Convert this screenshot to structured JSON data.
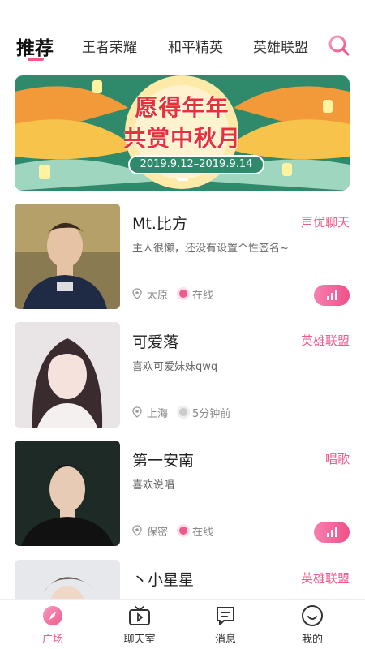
{
  "top_tabs": [
    {
      "label": "推荐",
      "active": true
    },
    {
      "label": "王者荣耀",
      "active": false
    },
    {
      "label": "和平精英",
      "active": false
    },
    {
      "label": "英雄联盟",
      "active": false
    }
  ],
  "banner": {
    "line1": "愿得年年",
    "line2": "共赏中秋月",
    "date_range": "2019.9.12–2019.9.14"
  },
  "users": [
    {
      "name": "Mt.比方",
      "tag": "声优聊天",
      "signature": "主人很懒，还没有设置个性签名~",
      "location": "太原",
      "status": "在线",
      "online": true,
      "voice_button": true
    },
    {
      "name": "可爱落",
      "tag": "英雄联盟",
      "signature": "喜欢可爱妹妹qwq",
      "location": "上海",
      "status": "5分钟前",
      "online": false,
      "voice_button": false
    },
    {
      "name": "第一安南",
      "tag": "唱歌",
      "signature": "喜欢说唱",
      "location": "保密",
      "status": "在线",
      "online": true,
      "voice_button": true
    },
    {
      "name": "丶小星星",
      "tag": "英雄联盟",
      "signature": "",
      "location": "",
      "status": "",
      "online": false,
      "voice_button": false
    }
  ],
  "bottom_nav": [
    {
      "label": "广场",
      "icon": "compass-icon",
      "active": true
    },
    {
      "label": "聊天室",
      "icon": "tv-icon",
      "active": false
    },
    {
      "label": "消息",
      "icon": "message-icon",
      "active": false
    },
    {
      "label": "我的",
      "icon": "smile-icon",
      "active": false
    }
  ],
  "colors": {
    "accent": "#f05a8e",
    "banner_green": "#2f8a6c",
    "banner_orange": "#f29a3a"
  }
}
